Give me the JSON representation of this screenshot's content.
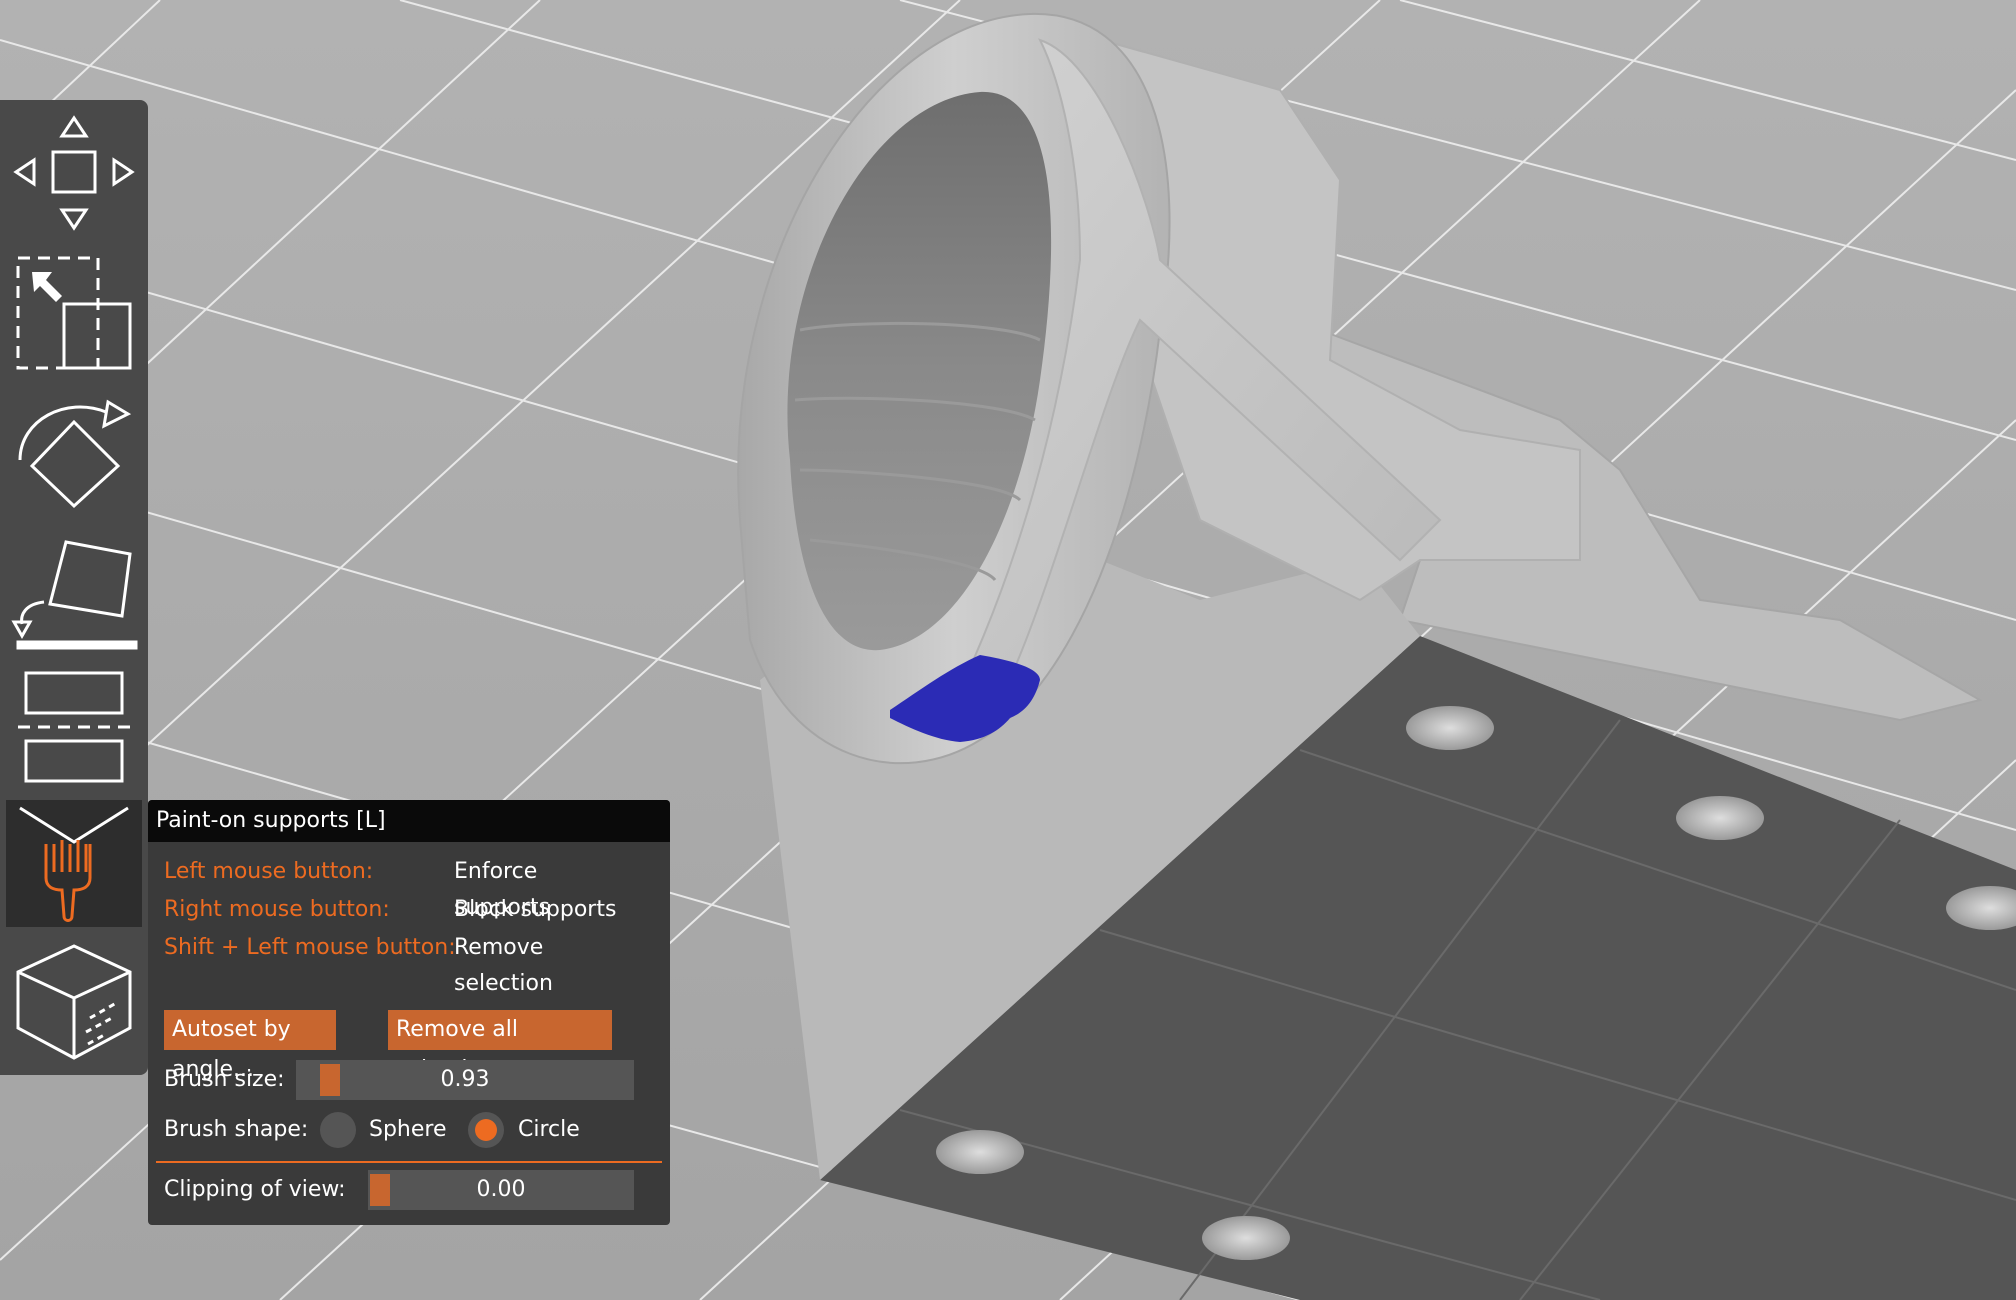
{
  "toolbar": {
    "tools": [
      {
        "name": "move-icon",
        "active": false
      },
      {
        "name": "scale-icon",
        "active": false
      },
      {
        "name": "rotate-icon",
        "active": false
      },
      {
        "name": "place-on-face-icon",
        "active": false
      },
      {
        "name": "cut-icon",
        "active": false
      },
      {
        "name": "paint-on-supports-icon",
        "active": true
      },
      {
        "name": "seam-painting-icon",
        "active": false
      }
    ]
  },
  "panel": {
    "title": "Paint-on supports [L]",
    "hints": [
      {
        "key": "Left mouse button:",
        "value": "Enforce supports"
      },
      {
        "key": "Right mouse button:",
        "value": "Block supports"
      },
      {
        "key": "Shift + Left mouse button:",
        "value": "Remove selection"
      }
    ],
    "autoset_label": "Autoset by angle...",
    "remove_all_label": "Remove all selection",
    "brush_size_label": "Brush size:",
    "brush_size_value": "0.93",
    "brush_shape_label": "Brush shape:",
    "shape_sphere_label": "Sphere",
    "shape_circle_label": "Circle",
    "shape_selected": "Circle",
    "clipping_label": "Clipping of view:",
    "clipping_value": "0.00"
  },
  "colors": {
    "accent": "#ed6b21",
    "button": "#c8662f",
    "enforcer_paint": "#2b2bb5",
    "bed_plate": "#555555",
    "model": "#c0c0c0"
  }
}
